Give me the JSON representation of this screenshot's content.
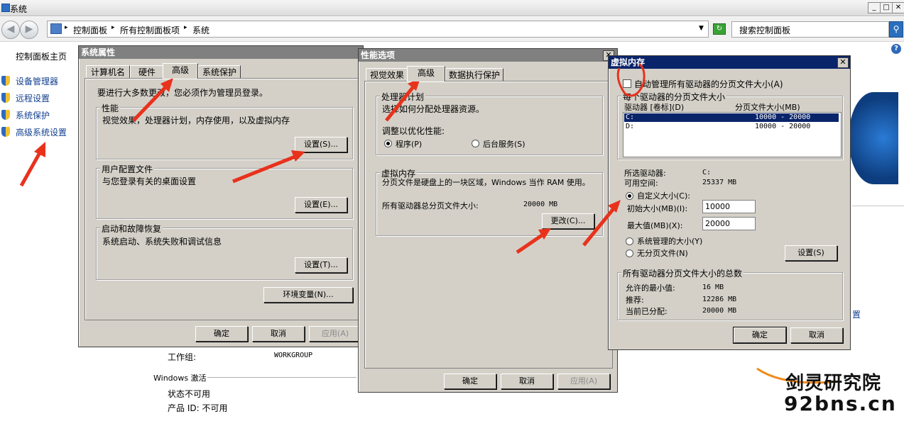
{
  "window": {
    "title": "系统"
  },
  "address": {
    "crumbs": [
      "控制面板",
      "所有控制面板项",
      "系统"
    ],
    "search_placeholder": "搜索控制面板"
  },
  "left_pane": {
    "home": "控制面板主页",
    "items": [
      "设备管理器",
      "远程设置",
      "系统保护",
      "高级系统设置"
    ]
  },
  "background_info": {
    "workgroup_label": "工作组:",
    "workgroup_value": "WORKGROUP",
    "activation_header": "Windows 激活",
    "status": "状态不可用",
    "product_id": "产品 ID: 不可用",
    "partial_link": "置"
  },
  "sys_props": {
    "title": "系统属性",
    "tabs": [
      "计算机名",
      "硬件",
      "高级",
      "系统保护"
    ],
    "admin_note": "要进行大多数更改，您必须作为管理员登录。",
    "perf": {
      "label": "性能",
      "desc": "视觉效果，处理器计划，内存使用，以及虚拟内存",
      "button": "设置(S)..."
    },
    "profile": {
      "label": "用户配置文件",
      "desc": "与您登录有关的桌面设置",
      "button": "设置(E)..."
    },
    "startup": {
      "label": "启动和故障恢复",
      "desc": "系统启动、系统失败和调试信息",
      "button": "设置(T)..."
    },
    "env_button": "环境变量(N)...",
    "ok": "确定",
    "cancel": "取消",
    "apply": "应用(A)"
  },
  "perf_opts": {
    "title": "性能选项",
    "tabs": [
      "视觉效果",
      "高级",
      "数据执行保护"
    ],
    "sched": {
      "label": "处理器计划",
      "desc": "选择如何分配处理器资源。",
      "adjust": "调整以优化性能:",
      "programs": "程序(P)",
      "services": "后台服务(S)"
    },
    "vm": {
      "label": "虚拟内存",
      "desc": "分页文件是硬盘上的一块区域，Windows 当作 RAM 使用。",
      "total_label": "所有驱动器总分页文件大小:",
      "total_value": "20000 MB",
      "change": "更改(C)..."
    },
    "ok": "确定",
    "cancel": "取消",
    "apply": "应用(A)"
  },
  "virt_mem": {
    "title": "虚拟内存",
    "auto_manage": "自动管理所有驱动器的分页文件大小(A)",
    "drives_group": "每个驱动器的分页文件大小",
    "col_drive": "驱动器 [卷标](D)",
    "col_size": "分页文件大小(MB)",
    "drives": [
      {
        "drive": "C:",
        "size": "10000 - 20000"
      },
      {
        "drive": "D:",
        "size": "10000 - 20000"
      }
    ],
    "selected_drive_label": "所选驱动器:",
    "selected_drive_value": "C:",
    "free_space_label": "可用空间:",
    "free_space_value": "25337 MB",
    "custom_size": "自定义大小(C):",
    "initial_label": "初始大小(MB)(I):",
    "initial_value": "10000",
    "max_label": "最大值(MB)(X):",
    "max_value": "20000",
    "system_managed": "系统管理的大小(Y)",
    "no_paging": "无分页文件(N)",
    "set_button": "设置(S)",
    "totals_group": "所有驱动器分页文件大小的总数",
    "min_label": "允许的最小值:",
    "min_value": "16 MB",
    "rec_label": "推荐:",
    "rec_value": "12286 MB",
    "cur_label": "当前已分配:",
    "cur_value": "20000 MB",
    "ok": "确定",
    "cancel": "取消"
  },
  "watermark": {
    "line1": "剑灵研究院",
    "line2": "92bns.cn"
  }
}
